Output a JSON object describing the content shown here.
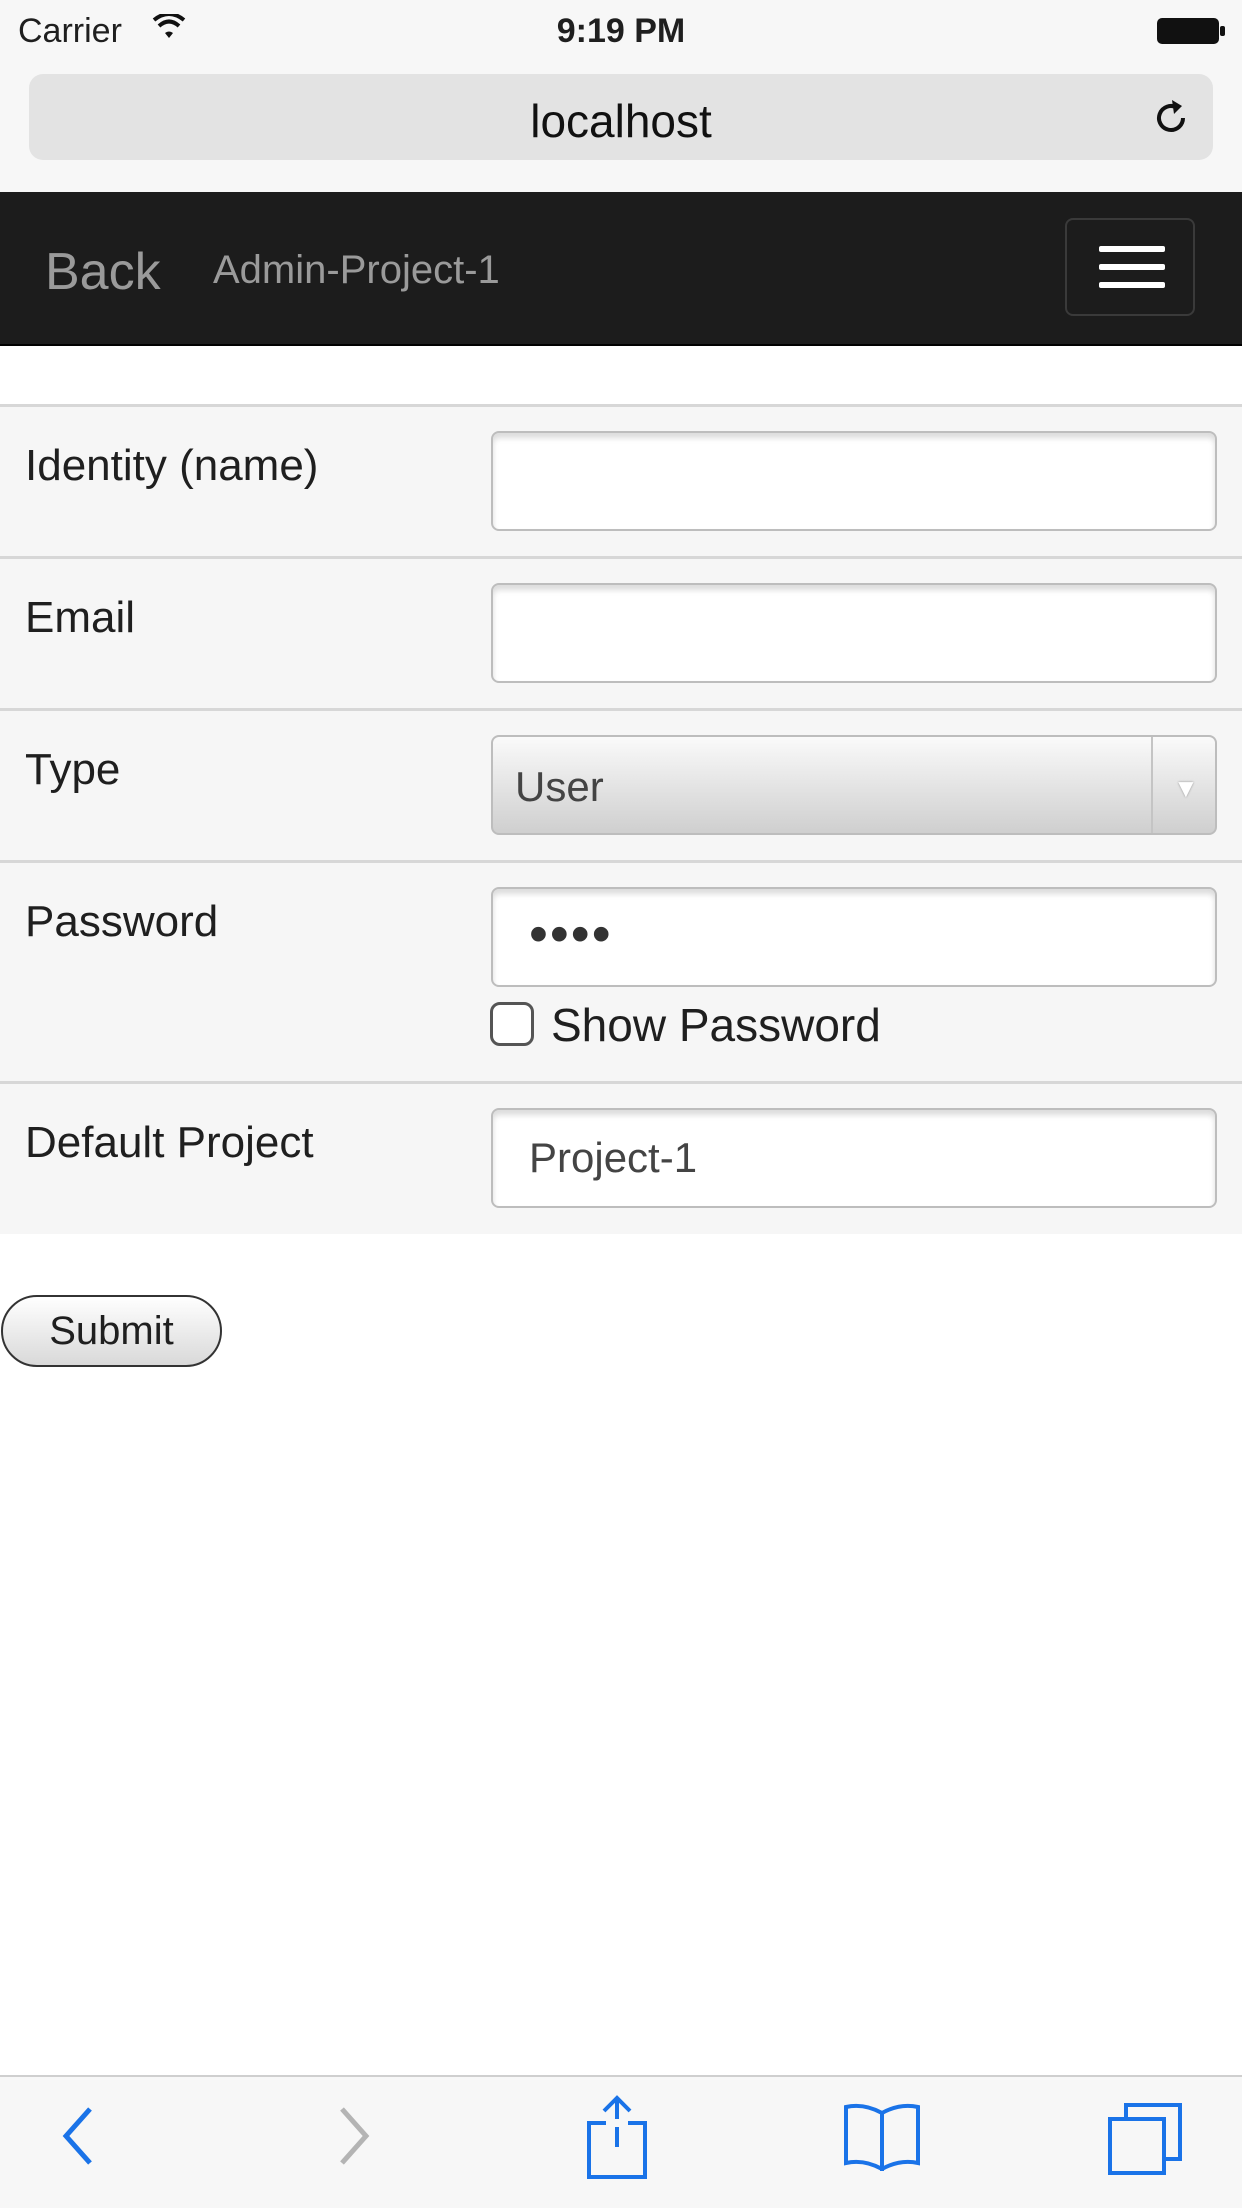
{
  "status_bar": {
    "carrier": "Carrier",
    "time": "9:19 PM"
  },
  "url_bar": {
    "host": "localhost"
  },
  "navbar": {
    "back_label": "Back",
    "title": "Admin-Project-1"
  },
  "form": {
    "identity": {
      "label": "Identity (name)",
      "value": "",
      "placeholder": ""
    },
    "email": {
      "label": "Email",
      "value": "",
      "placeholder": ""
    },
    "type": {
      "label": "Type",
      "selected": "User"
    },
    "password": {
      "label": "Password",
      "masked_value": "••••",
      "show_password_label": "Show Password",
      "show_password_checked": false
    },
    "default_project": {
      "label": "Default Project",
      "value": "Project-1"
    }
  },
  "submit_label": "Submit",
  "toolbar": {
    "icons": [
      "back-icon",
      "forward-icon",
      "share-icon",
      "bookmarks-icon",
      "tabs-icon"
    ],
    "accent_color": "#1a73e8",
    "disabled_color": "#b4b4b4"
  }
}
